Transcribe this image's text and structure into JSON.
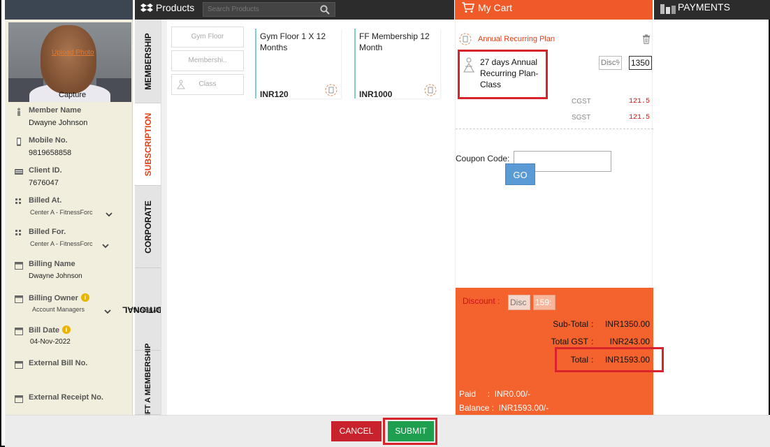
{
  "header": {
    "products_title": "Products",
    "search_placeholder": "Search Products",
    "cart_title": "My Cart",
    "payments_title": "PAYMENTS"
  },
  "member": {
    "upload_photo": "Upload Photo",
    "capture": "Capture",
    "fields": [
      {
        "label": "Member Name",
        "value": "Dwayne Johnson"
      },
      {
        "label": "Mobile No.",
        "value": "9819658858"
      },
      {
        "label": "Client ID.",
        "value": "7676047"
      },
      {
        "label": "Billed At.",
        "value": "Center A - FitnessForc"
      },
      {
        "label": "Billed For.",
        "value": "Center A - FitnessForc"
      },
      {
        "label": "Billing Name",
        "value": "Dwayne  Johnson"
      },
      {
        "label": "Billing Owner",
        "value": "Account Managers"
      },
      {
        "label": "Bill Date",
        "value": "04-Nov-2022"
      },
      {
        "label": "External Bill No.",
        "value": ""
      },
      {
        "label": "External Receipt No.",
        "value": ""
      }
    ]
  },
  "tabs": [
    {
      "label": "MEMBERSHIP"
    },
    {
      "label": "SUBSCRIPTION"
    },
    {
      "label": "CORPORATE"
    },
    {
      "label": "ADDITIONAL",
      "sub": "PAYMENTS"
    },
    {
      "label": "GIFT A MEMBERSHIP"
    }
  ],
  "categories": [
    "Gym Floor",
    "Membershi..",
    "Class"
  ],
  "products": [
    {
      "name": "Gym Floor 1 X 12 Months",
      "price": "INR120"
    },
    {
      "name": "FF Membership 12 Month",
      "price": "INR1000"
    }
  ],
  "cart": {
    "plan_title": "Annual Recurring Plan",
    "item_name": "27 days Annual Recurring Plan-Class",
    "disc_placeholder": "Disc%",
    "price_value": "1350",
    "cgst_label": "CGST",
    "cgst_value": "121.5",
    "sgst_label": "SGST",
    "sgst_value": "121.5",
    "coupon_label": "Coupon Code:",
    "go_label": "GO"
  },
  "summary": {
    "discount_label": "Discount :",
    "disc_box1": "Disc",
    "disc_box2": "159:",
    "subtotal_label": "Sub-Total",
    "subtotal_value": "INR1350.00",
    "gst_label": "Total GST",
    "gst_value": "INR243.00",
    "total_label": "Total",
    "total_value": "INR1593.00",
    "colon": ":",
    "paid": "Paid     :  INR0.00/-",
    "balance": "Balance :  INR1593.00/-"
  },
  "footer": {
    "cancel_label": "CANCEL",
    "submit_label": "SUBMIT"
  },
  "colors": {
    "accent_orange": "#f05a28",
    "highlight_red": "#d9232b",
    "submit_green": "#1e9e4f",
    "cancel_red": "#c8232c",
    "go_blue": "#5b9bd5"
  }
}
